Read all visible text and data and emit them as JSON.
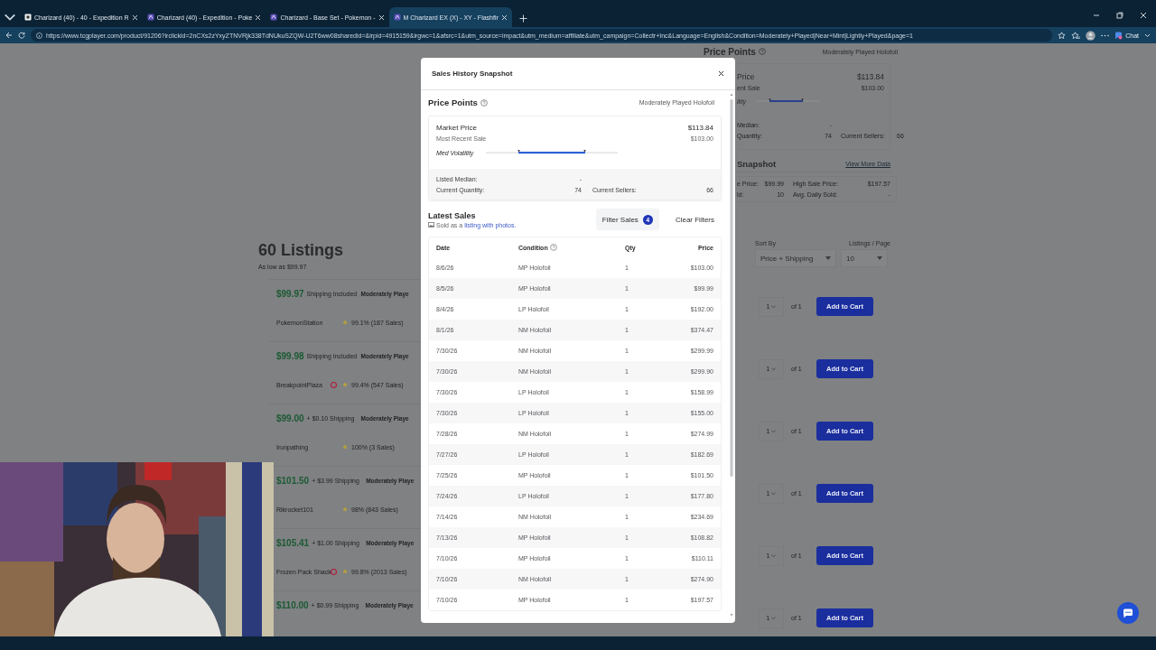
{
  "browser": {
    "tabs": [
      {
        "title": "Charizard (40) - 40 - Expedition R",
        "selected": false
      },
      {
        "title": "Charizard (40) - Expedition - Poke",
        "selected": false
      },
      {
        "title": "Charizard - Base Set - Pokemon - ",
        "selected": false
      },
      {
        "title": "M Charizard EX (X) - XY - Flashfir",
        "selected": true
      }
    ],
    "url": "https://www.tcgplayer.com/product/91206?irclickid=2nCXs2zYxyZTNVRjk338TdNUkuSZQW-U2T6ww08sharedid=&irpid=4915159&irgwc=1&afsrc=1&utm_source=impact&utm_medium=affiliate&utm_campaign=Collectr+Inc&Language=English&Condition=Moderately+Played|Near+Mint|Lightly+Played&page=1",
    "chat_button": "Chat"
  },
  "page": {
    "listings_title": "60 Listings",
    "low_price": "As low as $99.97",
    "listings": [
      {
        "price": "$99.97",
        "shipping": "Shipping Included",
        "condition": "Moderately Playe",
        "seller": "PokemonStation",
        "badge": false,
        "rating": "99.1% (187 Sales)"
      },
      {
        "price": "$99.98",
        "shipping": "Shipping Included",
        "condition": "Moderately Playe",
        "seller": "BreakpointPlaza",
        "badge": true,
        "rating": "99.4% (547 Sales)"
      },
      {
        "price": "$99.00",
        "shipping": "+ $0.10 Shipping",
        "condition": "Moderately Playe",
        "seller": "Irunpathing",
        "badge": false,
        "rating": "100% (3 Sales)"
      },
      {
        "price": "$101.50",
        "shipping": "+ $3.99 Shipping",
        "condition": "Moderately Playe",
        "seller": "Rikrocket101",
        "badge": false,
        "rating": "98% (843 Sales)"
      },
      {
        "price": "$105.41",
        "shipping": "+ $1.00 Shipping",
        "condition": "Moderately Playe",
        "seller": "Frozen Pack Shack",
        "badge": true,
        "rating": "99.8% (2013 Sales)"
      },
      {
        "price": "$110.00",
        "shipping": "+ $0.99 Shipping",
        "condition": "Moderately Playe"
      }
    ],
    "price_points": {
      "title": "Price Points",
      "condition": "Moderately Played Holofoil",
      "market_label": "Price",
      "market_value": "$113.84",
      "recent_label": "ent Sale",
      "recent_value": "$103.00",
      "volatility_label": "ility",
      "median_label": "Median:",
      "median_value": "-",
      "quantity_label": "Quantity:",
      "quantity_value": "74",
      "sellers_label": "Current Sellers:",
      "sellers_value": "66"
    },
    "snapshot": {
      "title": "Snapshot",
      "link": "View More Data",
      "stats": [
        {
          "label": "e Price:",
          "value": "$99.99",
          "label_2": "High Sale Price:",
          "value_2": "$197.57"
        },
        {
          "label": "ld:",
          "value": "10",
          "label_2": "Avg. Daily Sold:",
          "value_2": "-"
        }
      ]
    },
    "sort": {
      "sort_label": "Sort By",
      "sort_value": "Price + Shipping",
      "per_page_label": "Listings / Page",
      "per_page_value": "10"
    },
    "cart_rows": [
      {
        "quantity": "1",
        "of": "of 1",
        "button": "Add to Cart"
      },
      {
        "quantity": "1",
        "of": "of 1",
        "button": "Add to Cart"
      },
      {
        "quantity": "1",
        "of": "of 1",
        "button": "Add to Cart"
      },
      {
        "quantity": "1",
        "of": "of 1",
        "button": "Add to Cart"
      },
      {
        "quantity": "1",
        "of": "of 1",
        "button": "Add to Cart"
      },
      {
        "quantity": "1",
        "of": "of 1",
        "button": "Add to Cart"
      }
    ]
  },
  "modal": {
    "title": "Sales History Snapshot",
    "price_points_title": "Price Points",
    "condition": "Moderately Played Holofoil",
    "market_label": "Market Price",
    "market_value": "$113.84",
    "recent_label": "Most Recent Sale",
    "recent_value": "$103.00",
    "volatility_label": "Med Volatility",
    "median_label": "Listed Median:",
    "median_value": "-",
    "quantity_label": "Current Quantity:",
    "quantity_value": "74",
    "sellers_label": "Current Sellers:",
    "sellers_value": "66",
    "latest_title": "Latest Sales",
    "photo_note": "Sold as a",
    "photo_link": "listing with photos.",
    "filter_button": "Filter Sales",
    "filter_count": "4",
    "clear_button": "Clear Filters",
    "columns": [
      "Date",
      "Condition",
      "Qty",
      "Price"
    ],
    "rows": [
      {
        "date": "8/6/26",
        "condition": "MP Holofoil",
        "qty": "1",
        "price": "$103.00"
      },
      {
        "date": "8/5/26",
        "condition": "MP Holofoil",
        "qty": "1",
        "price": "$99.99"
      },
      {
        "date": "8/4/26",
        "condition": "LP Holofoil",
        "qty": "1",
        "price": "$192.00"
      },
      {
        "date": "8/1/26",
        "condition": "NM Holofoil",
        "qty": "1",
        "price": "$374.47"
      },
      {
        "date": "7/30/26",
        "condition": "NM Holofoil",
        "qty": "1",
        "price": "$299.99"
      },
      {
        "date": "7/30/26",
        "condition": "NM Holofoil",
        "qty": "1",
        "price": "$299.90"
      },
      {
        "date": "7/30/26",
        "condition": "LP Holofoil",
        "qty": "1",
        "price": "$158.99"
      },
      {
        "date": "7/30/26",
        "condition": "LP Holofoil",
        "qty": "1",
        "price": "$155.00"
      },
      {
        "date": "7/28/26",
        "condition": "NM Holofoil",
        "qty": "1",
        "price": "$274.99"
      },
      {
        "date": "7/27/26",
        "condition": "LP Holofoil",
        "qty": "1",
        "price": "$182.69"
      },
      {
        "date": "7/25/26",
        "condition": "MP Holofoil",
        "qty": "1",
        "price": "$101.50"
      },
      {
        "date": "7/24/26",
        "condition": "LP Holofoil",
        "qty": "1",
        "price": "$177.80"
      },
      {
        "date": "7/14/26",
        "condition": "NM Holofoil",
        "qty": "1",
        "price": "$234.69"
      },
      {
        "date": "7/13/26",
        "condition": "MP Holofoil",
        "qty": "1",
        "price": "$108.82"
      },
      {
        "date": "7/10/26",
        "condition": "MP Holofoil",
        "qty": "1",
        "price": "$110.11"
      },
      {
        "date": "7/10/26",
        "condition": "NM Holofoil",
        "qty": "1",
        "price": "$274.90"
      },
      {
        "date": "7/10/26",
        "condition": "MP Holofoil",
        "qty": "1",
        "price": "$197.57"
      }
    ]
  }
}
